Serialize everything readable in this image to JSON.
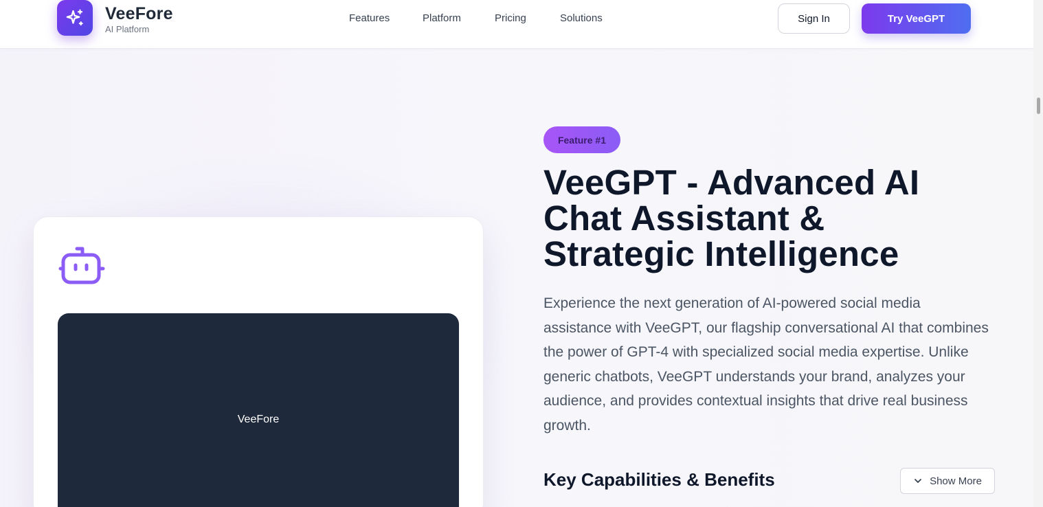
{
  "brand": {
    "name": "VeeFore",
    "subtitle": "AI Platform",
    "logo_icon": "sparkles-icon"
  },
  "nav": {
    "items": [
      {
        "label": "Features"
      },
      {
        "label": "Platform"
      },
      {
        "label": "Pricing"
      },
      {
        "label": "Solutions"
      }
    ]
  },
  "header_actions": {
    "sign_in": "Sign In",
    "try": "Try VeeGPT"
  },
  "card": {
    "icon": "bot-icon",
    "video_label": "VeeFore"
  },
  "feature": {
    "badge": "Feature #1",
    "headline_lines": [
      "VeeGPT - Advanced AI",
      "Chat Assistant &",
      "Strategic Intelligence"
    ],
    "description": "Experience the next generation of AI-powered social media assistance with VeeGPT, our flagship conversational AI that combines the power of GPT-4 with specialized social media expertise. Unlike generic chatbots, VeeGPT understands your brand, analyzes your audience, and provides contextual insights that drive real business growth.",
    "section_title": "Key Capabilities & Benefits",
    "show_more": "Show More",
    "show_more_icon": "chevron-down-icon"
  },
  "colors": {
    "accent_purple": "#7c3aed",
    "accent_blue": "#4f6ef0",
    "headline": "#0f172a",
    "video_bg": "#1e293b"
  }
}
